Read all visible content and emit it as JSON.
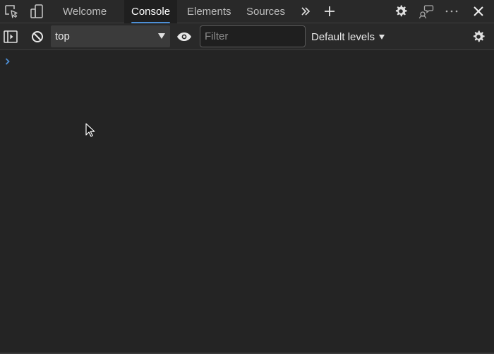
{
  "tabs": [
    {
      "label": "Welcome",
      "active": false
    },
    {
      "label": "Console",
      "active": true
    },
    {
      "label": "Elements",
      "active": false
    },
    {
      "label": "Sources",
      "active": false
    }
  ],
  "toolbar": {
    "context": "top",
    "filter_placeholder": "Filter",
    "filter_value": "",
    "levels_label": "Default levels"
  },
  "icons": {
    "inspect": "inspect-element-icon",
    "device": "device-emulation-icon",
    "more_tabs": "chevron-double-right-icon",
    "add_tab": "plus-icon",
    "settings": "gear-icon",
    "feedback": "feedback-icon",
    "menu": "more-horizontal-icon",
    "close": "close-icon",
    "sidebar": "sidebar-toggle-icon",
    "clear": "clear-console-icon",
    "live_expression": "eye-icon",
    "console_settings": "gear-icon",
    "prompt": "chevron-right-icon"
  },
  "colors": {
    "background": "#242424",
    "toolbar": "#292929",
    "active_tab_underline": "#4d8fd6",
    "prompt": "#4d8fd6"
  }
}
